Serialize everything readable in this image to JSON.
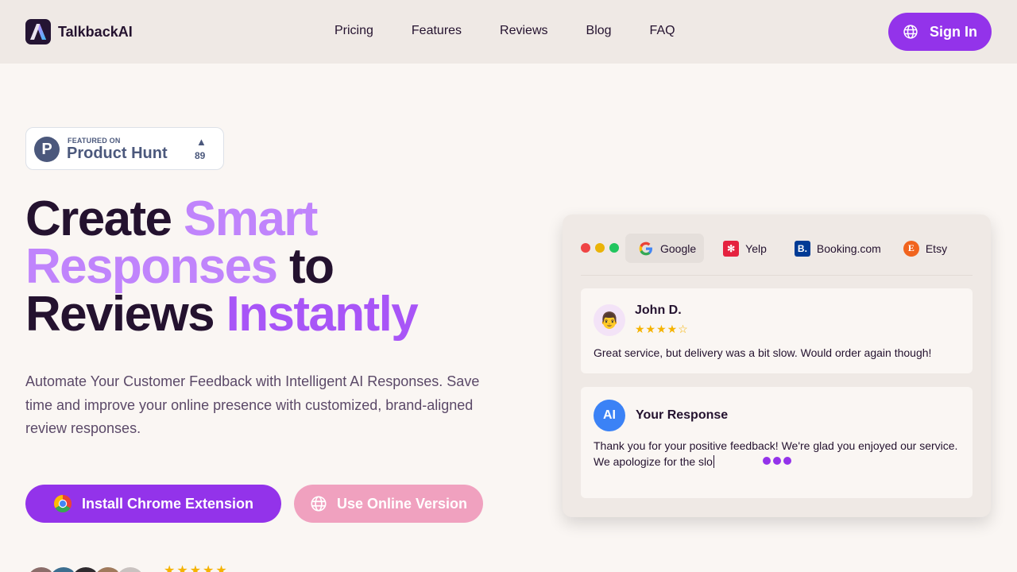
{
  "brand": {
    "name": "TalkbackAI"
  },
  "nav": {
    "items": [
      "Pricing",
      "Features",
      "Reviews",
      "Blog",
      "FAQ"
    ]
  },
  "header": {
    "signin_label": "Sign In"
  },
  "product_hunt": {
    "featured": "FEATURED ON",
    "name": "Product Hunt",
    "votes": "89"
  },
  "hero": {
    "title_1": "Create",
    "title_2": "Smart",
    "title_3": "Responses",
    "title_4": "to",
    "title_5": "Reviews",
    "title_6": "Instantly",
    "subtitle": "Automate Your Customer Feedback with Intelligent AI Responses. Save time and improve your online presence with customized, brand-aligned review responses.",
    "btn_chrome": "Install Chrome Extension",
    "btn_online": "Use Online Version",
    "rating_stars": "★★★★★"
  },
  "mockup": {
    "tabs": [
      {
        "label": "Google",
        "icon": "google-icon"
      },
      {
        "label": "Yelp",
        "icon": "yelp-icon"
      },
      {
        "label": "Booking.com",
        "icon": "booking-icon"
      },
      {
        "label": "Etsy",
        "icon": "etsy-icon"
      }
    ],
    "review": {
      "avatar": "👨",
      "name": "John D.",
      "stars": "★★★★☆",
      "rating": 4,
      "text": "Great service, but delivery was a bit slow. Would order again though!"
    },
    "response": {
      "avatar": "AI",
      "title": "Your Response",
      "text": "Thank you for your positive feedback! We're glad you enjoyed our service. We apologize for the slo"
    }
  },
  "colors": {
    "accent": "#9333ea",
    "accent_light": "#c084fc",
    "secondary_button": "#f0a1bf",
    "star": "#f5b301"
  }
}
